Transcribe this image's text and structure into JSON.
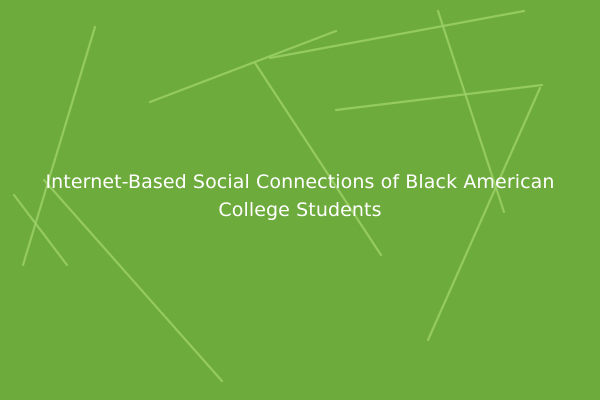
{
  "cover": {
    "title": "Internet-Based Social Connections of Black American College Students",
    "background_color": "#6dab3c",
    "line_color": "#9dd068"
  }
}
